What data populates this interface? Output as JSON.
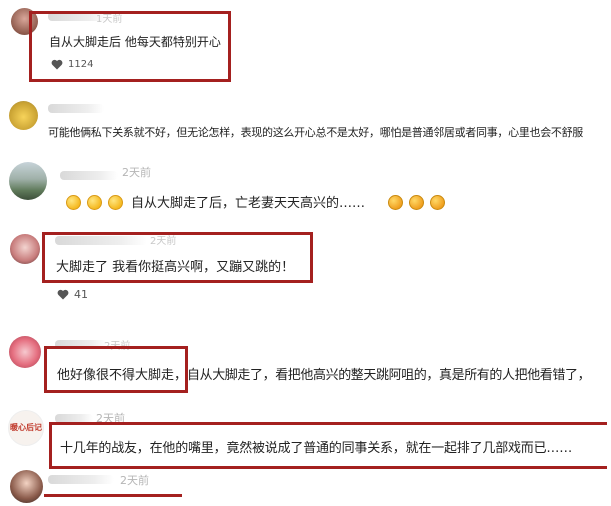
{
  "comments": [
    {
      "time": "1天前",
      "text": "自从大脚走后 他每天都特别开心",
      "likes": "1124"
    },
    {
      "time": "",
      "text": "可能他俩私下关系就不好，但无论怎样，表现的这么开心总不是太好，哪怕是普通邻居或者同事，心里也会不舒服",
      "likes": ""
    },
    {
      "time": "2天前",
      "text": "自从大脚走了后，亡老妻天天高兴的……",
      "likes": ""
    },
    {
      "time": "2天前",
      "text": "大脚走了 我看你挺高兴啊，又蹦又跳的！",
      "likes": "41"
    },
    {
      "time": "2天前",
      "text_boxed": "他好像很不得大脚走，",
      "text_rest": "自从大脚走了，看把他高兴的整天跳阿咀的，真是所有的人把他看错了，",
      "likes": ""
    },
    {
      "time": "2天前",
      "avatar_label": "暖心后记",
      "text": "十几年的战友，在他的嘴里，竟然被说成了普通的同事关系，就在一起排了几部戏而已……",
      "likes": ""
    },
    {
      "time": "2天前",
      "text": "",
      "likes": ""
    }
  ],
  "icons": {
    "like": "heart-icon",
    "emoji_smile": "smile-emoji-icon",
    "emoji_laugh": "laugh-cry-emoji-icon"
  },
  "colors": {
    "highlight_box": "#a4201f",
    "time_text": "#b5b5b5"
  }
}
